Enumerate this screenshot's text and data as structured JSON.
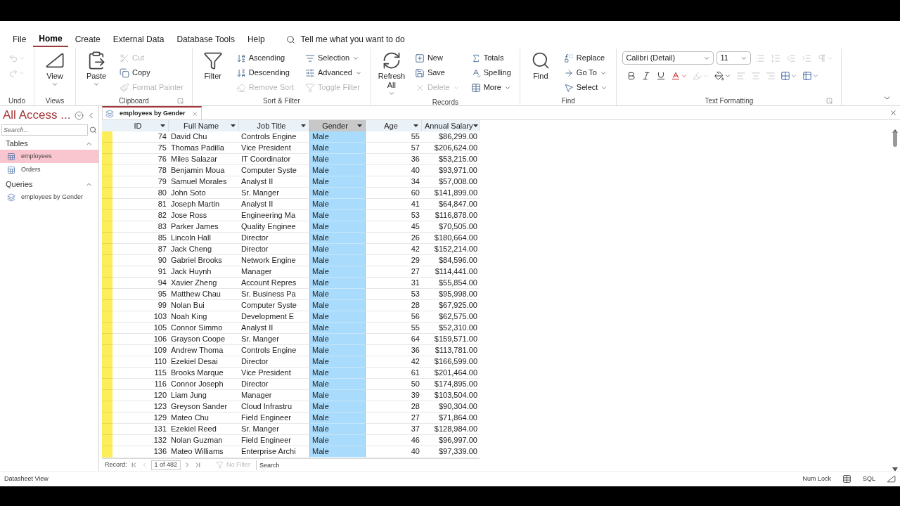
{
  "menu_tabs": [
    {
      "label": "File",
      "selected": false
    },
    {
      "label": "Home",
      "selected": true
    },
    {
      "label": "Create",
      "selected": false
    },
    {
      "label": "External Data",
      "selected": false
    },
    {
      "label": "Database Tools",
      "selected": false
    },
    {
      "label": "Help",
      "selected": false
    }
  ],
  "tell_me": "Tell me what you want to do",
  "ribbon": {
    "groups": [
      {
        "kind": "buttons",
        "label": "Undo",
        "small": [
          {
            "disabled": true,
            "dropdown": true
          },
          {
            "disabled": true,
            "dropdown": true
          }
        ]
      },
      {
        "kind": "buttons",
        "label": "Views",
        "large": [
          {
            "label": "View",
            "dropdown": true,
            "disabled": false
          }
        ]
      },
      {
        "kind": "buttons",
        "label": "Clipboard",
        "launcher": true,
        "large": [
          {
            "label": "Paste",
            "dropdown": true,
            "disabled": false
          }
        ],
        "small": [
          {
            "label": "Cut",
            "disabled": true,
            "dropdown": false
          },
          {
            "label": "Copy",
            "disabled": false,
            "dropdown": false
          },
          {
            "label": "Format Painter",
            "disabled": true,
            "dropdown": false
          }
        ]
      },
      {
        "kind": "buttons",
        "label": "Sort & Filter",
        "large": [
          {
            "label": "Filter",
            "dropdown": false,
            "disabled": false
          }
        ],
        "small": [
          {
            "label": "Ascending",
            "disabled": false,
            "dropdown": false
          },
          {
            "label": "Descending",
            "disabled": false,
            "dropdown": false
          },
          {
            "label": "Remove Sort",
            "disabled": true,
            "dropdown": false
          },
          {
            "label": "Selection",
            "disabled": false,
            "dropdown": true
          },
          {
            "label": "Advanced",
            "disabled": false,
            "dropdown": true
          },
          {
            "label": "Toggle Filter",
            "disabled": true,
            "dropdown": false
          }
        ]
      },
      {
        "kind": "buttons",
        "label": "Records",
        "large": [
          {
            "label": "Refresh All",
            "dropdown": true,
            "disabled": false
          }
        ],
        "small": [
          {
            "label": "New",
            "disabled": false,
            "dropdown": false
          },
          {
            "label": "Save",
            "disabled": false,
            "dropdown": false
          },
          {
            "label": "Delete",
            "disabled": true,
            "dropdown": true
          },
          {
            "label": "Totals",
            "disabled": false,
            "dropdown": false
          },
          {
            "label": "Spelling",
            "disabled": false,
            "dropdown": false
          },
          {
            "label": "More",
            "disabled": false,
            "dropdown": true
          }
        ]
      },
      {
        "kind": "buttons",
        "label": "Find",
        "large": [
          {
            "label": "Find",
            "dropdown": false,
            "disabled": false
          }
        ],
        "small": [
          {
            "label": "Replace",
            "disabled": false,
            "dropdown": false
          },
          {
            "label": "Go To",
            "disabled": false,
            "dropdown": true
          },
          {
            "label": "Select",
            "disabled": false,
            "dropdown": true
          }
        ]
      },
      {
        "kind": "format",
        "label": "Text Formatting",
        "launcher": true,
        "font": "Calibri (Detail)",
        "size": "11",
        "top": [
          {
            "disabled": true,
            "dropdown": false
          },
          {
            "disabled": true,
            "dropdown": false
          },
          {
            "disabled": true,
            "dropdown": false
          },
          {
            "disabled": true,
            "dropdown": false
          },
          {
            "disabled": true,
            "dropdown": true
          }
        ],
        "bottom": [
          {
            "disabled": false,
            "dropdown": false
          },
          {
            "disabled": false,
            "dropdown": false
          },
          {
            "disabled": false,
            "dropdown": false
          },
          {
            "disabled": false,
            "dropdown": true
          },
          {
            "disabled": true,
            "dropdown": true
          },
          {
            "disabled": false,
            "dropdown": true
          },
          {
            "disabled": true,
            "dropdown": false
          },
          {
            "disabled": true,
            "dropdown": false
          },
          {
            "disabled": true,
            "dropdown": false
          },
          {
            "disabled": false,
            "dropdown": true
          },
          {
            "disabled": false,
            "dropdown": true
          }
        ]
      }
    ]
  },
  "nav_pane": {
    "title": "All Access ...",
    "search": {
      "placeholder": "Search..."
    },
    "sections": [
      {
        "label": "Tables",
        "expanded": true,
        "items": [
          {
            "label": "employees",
            "kind": "table",
            "selected": true
          },
          {
            "label": "Orders",
            "kind": "table",
            "selected": false
          }
        ]
      },
      {
        "label": "Queries",
        "expanded": true,
        "items": [
          {
            "label": "employees by Gender",
            "kind": "query",
            "selected": false
          }
        ]
      }
    ]
  },
  "document_tab": {
    "title": "employees by Gender"
  },
  "table": {
    "columns": [
      {
        "label": "ID",
        "selected": false,
        "kind": "number"
      },
      {
        "label": "Full Name",
        "selected": false,
        "kind": "text"
      },
      {
        "label": "Job Title",
        "selected": false,
        "kind": "text"
      },
      {
        "label": "Gender",
        "selected": true,
        "kind": "text"
      },
      {
        "label": "Age",
        "selected": false,
        "kind": "number"
      },
      {
        "label": "Annual Salary",
        "selected": false,
        "kind": "number"
      }
    ],
    "rows": [
      [
        "74",
        "David Chu",
        "Controls Engine",
        "Male",
        "55",
        "$86,299.00"
      ],
      [
        "75",
        "Thomas Padilla",
        "Vice President",
        "Male",
        "57",
        "$206,624.00"
      ],
      [
        "76",
        "Miles Salazar",
        "IT Coordinator",
        "Male",
        "36",
        "$53,215.00"
      ],
      [
        "78",
        "Benjamin Moua",
        "Computer Syste",
        "Male",
        "40",
        "$93,971.00"
      ],
      [
        "79",
        "Samuel Morales",
        "Analyst II",
        "Male",
        "34",
        "$57,008.00"
      ],
      [
        "80",
        "John Soto",
        "Sr. Manger",
        "Male",
        "60",
        "$141,899.00"
      ],
      [
        "81",
        "Joseph Martin",
        "Analyst II",
        "Male",
        "41",
        "$64,847.00"
      ],
      [
        "82",
        "Jose Ross",
        "Engineering Ma",
        "Male",
        "53",
        "$116,878.00"
      ],
      [
        "83",
        "Parker James",
        "Quality Enginee",
        "Male",
        "45",
        "$70,505.00"
      ],
      [
        "85",
        "Lincoln Hall",
        "Director",
        "Male",
        "26",
        "$180,664.00"
      ],
      [
        "87",
        "Jack Cheng",
        "Director",
        "Male",
        "42",
        "$152,214.00"
      ],
      [
        "90",
        "Gabriel Brooks",
        "Network Engine",
        "Male",
        "29",
        "$84,596.00"
      ],
      [
        "91",
        "Jack Huynh",
        "Manager",
        "Male",
        "27",
        "$114,441.00"
      ],
      [
        "94",
        "Xavier Zheng",
        "Account Repres",
        "Male",
        "31",
        "$55,854.00"
      ],
      [
        "95",
        "Matthew Chau",
        "Sr. Business Pa",
        "Male",
        "53",
        "$95,998.00"
      ],
      [
        "99",
        "Nolan Bui",
        "Computer Syste",
        "Male",
        "28",
        "$67,925.00"
      ],
      [
        "103",
        "Noah King",
        "Development E",
        "Male",
        "56",
        "$62,575.00"
      ],
      [
        "105",
        "Connor Simmo",
        "Analyst II",
        "Male",
        "55",
        "$52,310.00"
      ],
      [
        "106",
        "Grayson Coope",
        "Sr. Manger",
        "Male",
        "64",
        "$159,571.00"
      ],
      [
        "109",
        "Andrew Thoma",
        "Controls Engine",
        "Male",
        "36",
        "$113,781.00"
      ],
      [
        "110",
        "Ezekiel Desai",
        "Director",
        "Male",
        "42",
        "$166,599.00"
      ],
      [
        "115",
        "Brooks Marque",
        "Vice President",
        "Male",
        "61",
        "$201,464.00"
      ],
      [
        "116",
        "Connor Joseph",
        "Director",
        "Male",
        "50",
        "$174,895.00"
      ],
      [
        "120",
        "Liam Jung",
        "Manager",
        "Male",
        "39",
        "$103,504.00"
      ],
      [
        "123",
        "Greyson Sander",
        "Cloud Infrastru",
        "Male",
        "28",
        "$90,304.00"
      ],
      [
        "129",
        "Mateo Chu",
        "Field Engineer",
        "Male",
        "27",
        "$71,864.00"
      ],
      [
        "131",
        "Ezekiel Reed",
        "Sr. Manger",
        "Male",
        "37",
        "$128,984.00"
      ],
      [
        "132",
        "Nolan Guzman",
        "Field Engineer",
        "Male",
        "46",
        "$96,997.00"
      ],
      [
        "136",
        "Mateo Williams",
        "Enterprise Archi",
        "Male",
        "40",
        "$97,339.00"
      ]
    ]
  },
  "record_nav": {
    "label": "Record:",
    "position": "1 of 482",
    "filter": {
      "label": "No Filter",
      "disabled": true
    },
    "search": {
      "placeholder": "Search"
    }
  },
  "status_bar": {
    "left": "Datasheet View",
    "indicator": "Num Lock",
    "view": "SQL"
  }
}
